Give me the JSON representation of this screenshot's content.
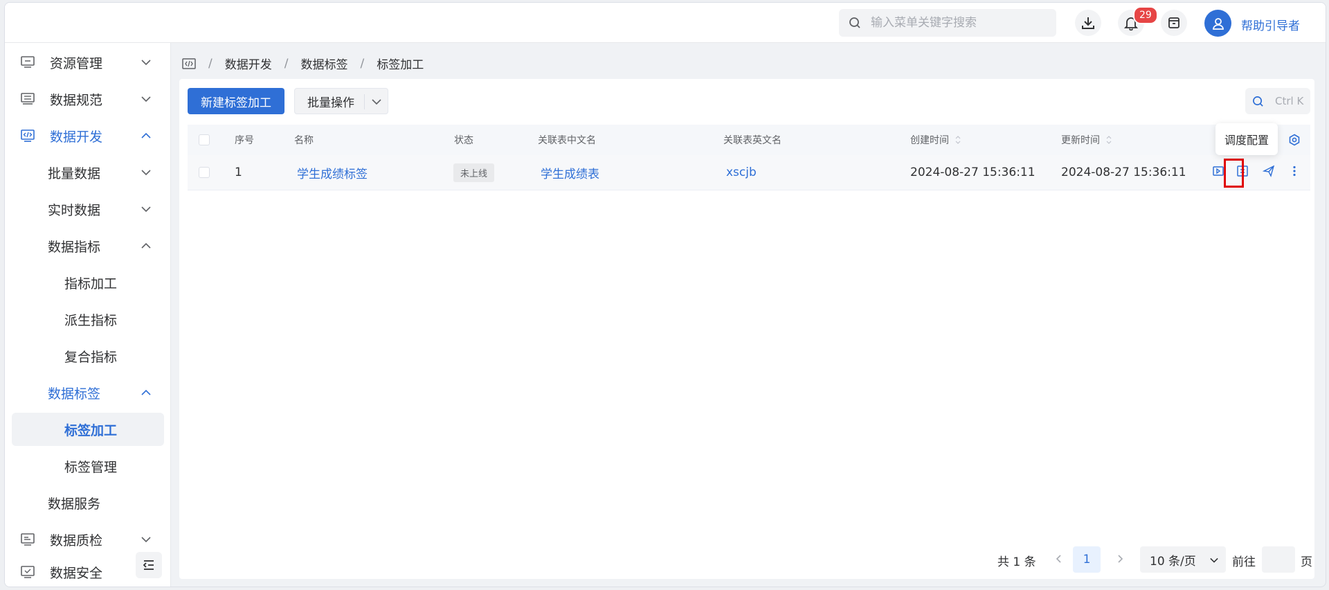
{
  "header": {
    "search_placeholder": "输入菜单关键字搜索",
    "notification_count": "29",
    "username": "帮助引导者"
  },
  "sidebar": {
    "items": [
      {
        "label": "资源管理",
        "icon": "monitor-icon"
      },
      {
        "label": "数据规范",
        "icon": "server-icon"
      },
      {
        "label": "数据开发",
        "icon": "code-icon"
      },
      {
        "label": "批量数据"
      },
      {
        "label": "实时数据"
      },
      {
        "label": "数据指标"
      },
      {
        "label": "指标加工"
      },
      {
        "label": "派生指标"
      },
      {
        "label": "复合指标"
      },
      {
        "label": "数据标签"
      },
      {
        "label": "标签加工"
      },
      {
        "label": "标签管理"
      },
      {
        "label": "数据服务"
      },
      {
        "label": "数据质检",
        "icon": "inspect-icon"
      },
      {
        "label": "数据安全",
        "icon": "shield-screen-icon"
      }
    ]
  },
  "breadcrumb": [
    "数据开发",
    "数据标签",
    "标签加工"
  ],
  "toolbar": {
    "new_label": "新建标签加工",
    "batch_label": "批量操作",
    "search_hint": "Ctrl K"
  },
  "table": {
    "columns": [
      "序号",
      "名称",
      "状态",
      "关联表中文名",
      "关联表英文名",
      "创建时间",
      "更新时间"
    ],
    "rows": [
      {
        "index": "1",
        "name": "学生成绩标签",
        "status": "未上线",
        "table_cn": "学生成绩表",
        "table_en": "xscjb",
        "created": "2024-08-27 15:36:11",
        "updated": "2024-08-27 15:36:11"
      }
    ]
  },
  "tooltip": "调度配置",
  "pagination": {
    "total": "共 1 条",
    "current": "1",
    "page_size": "10 条/页",
    "goto_prefix": "前往",
    "goto_suffix": "页"
  },
  "colors": {
    "primary": "#2f6fd6",
    "badge": "#e64545",
    "highlight": "#e00000"
  }
}
